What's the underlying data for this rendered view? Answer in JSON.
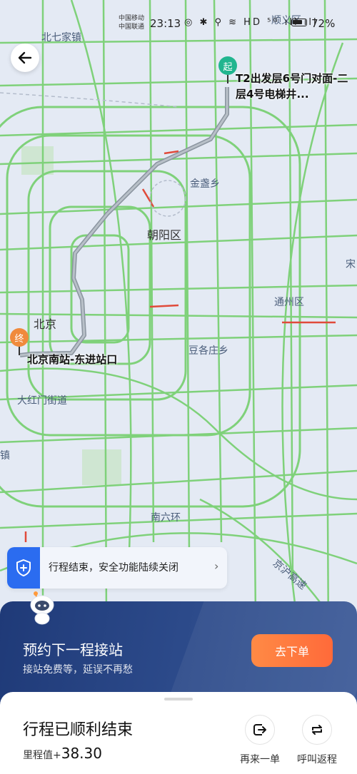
{
  "status_bar": {
    "carrier_1": "中国移动",
    "carrier_2": "中国联通",
    "time": "23:13",
    "icons": "◎ ✱ ⚲ ≋ HD ⁵ᴳ ıll ıll",
    "battery": "72%"
  },
  "map": {
    "labels": {
      "beiqijia": "北七家镇",
      "shunyi": "顺义区",
      "jinzhan": "金盏乡",
      "chaoyang": "朝阳区",
      "beijing": "北京",
      "tongzhou": "通州区",
      "doujiazhuang": "豆各庄乡",
      "dahongmen": "大红门街道",
      "zhen": "镇",
      "nanliuhuan": "南六环",
      "jinghu": "京沪高速",
      "song": "宋"
    },
    "start_pin": "起",
    "end_pin": "终",
    "start_location": "T2出发层6号门对面-二层4号电梯井...",
    "end_location": "北京南站-东进站口",
    "route_color": "#9aa3ae",
    "road_color": "#7fd17a"
  },
  "safety_banner": {
    "text": "行程结束，安全功能陆续关闭"
  },
  "promo": {
    "title": "预约下一程接站",
    "subtitle": "接站免费等，延误不再愁",
    "button": "去下单"
  },
  "sheet": {
    "title": "行程已顺利结束",
    "mileage_label": "里程值+",
    "mileage_value": "38.30",
    "actions": [
      {
        "label": "再来一单",
        "icon": "arrow-into-circle-icon"
      },
      {
        "label": "呼叫返程",
        "icon": "swap-arrows-icon"
      }
    ]
  }
}
